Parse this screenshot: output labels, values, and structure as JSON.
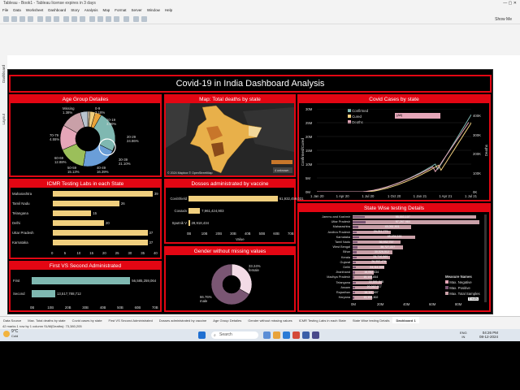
{
  "window": {
    "title": "Tableau - Book1 - Tableau license expires in 3 days"
  },
  "menu": [
    "File",
    "Data",
    "Worksheet",
    "Dashboard",
    "Story",
    "Analysis",
    "Map",
    "Format",
    "Server",
    "Window",
    "Help"
  ],
  "toolbar": {
    "show_me": "Show Me"
  },
  "side": {
    "dashboard": "Dashboard",
    "layout": "Layout"
  },
  "dashboard": {
    "title": "Covid-19 in India Dashboard Analysis",
    "age": {
      "title": "Age Group Detailes",
      "labels": [
        {
          "name": "Missing",
          "pct": "1.38%"
        },
        {
          "name": "0-9",
          "pct": "3.18%"
        },
        {
          "name": "10-19",
          "pct": "3.90%"
        },
        {
          "name": "20-29",
          "pct": "24.86%"
        },
        {
          "name": "30-39",
          "pct": "21.10%"
        },
        {
          "name": "40-49",
          "pct": "16.39%"
        },
        {
          "name": "50-59",
          "pct": "15.13%"
        },
        {
          "name": "60-69",
          "pct": "12.88%"
        },
        {
          "name": "70-79",
          "pct": "4.55%"
        }
      ]
    },
    "map": {
      "title": "Map: Total deaths by state",
      "credit": "© 2024 Mapbox © OpenStreetMap",
      "unknown": "4 unknown"
    },
    "cases": {
      "title": "Covid Cases by state",
      "legend": [
        "Confirmed",
        "Cured",
        "Deaths"
      ],
      "filter": "(All)",
      "ylabel_left": "Confirmed/Cured",
      "ylabel_right": "Deaths",
      "y_left_ticks": [
        "30M",
        "25M",
        "20M",
        "15M",
        "10M",
        "5M",
        "0M"
      ],
      "y_right_ticks": [
        "400K",
        "300K",
        "200K",
        "100K",
        "0K"
      ],
      "x_ticks": [
        "1 Jan 20",
        "1 Apr 20",
        "1 Jul 20",
        "1 Oct 20",
        "1 Jan 21",
        "1 Apr 21",
        "1 Jul 21"
      ]
    },
    "icmr": {
      "title": "ICMR Testing Labs in each State",
      "rows": [
        {
          "state": "Maharashtra",
          "value": "39"
        },
        {
          "state": "Tamil Nadu",
          "value": "26"
        },
        {
          "state": "Telangana",
          "value": "15"
        },
        {
          "state": "Delhi",
          "value": "20"
        },
        {
          "state": "Uttar Pradesh",
          "value": "37"
        },
        {
          "state": "Karnataka",
          "value": "37"
        }
      ],
      "axis": [
        "0",
        "5",
        "10",
        "15",
        "20",
        "25",
        "30",
        "35",
        "40"
      ]
    },
    "vaccine": {
      "title": "Dosses administrated by vaccine",
      "rows": [
        {
          "name": "CoviShield",
          "value": "61,932,459,031"
        },
        {
          "name": "Covaxin",
          "value": "7,961,424,903"
        },
        {
          "name": "Sputnik V",
          "value": "28,918,434"
        }
      ],
      "axis": [
        "0B",
        "10B",
        "20B",
        "30B",
        "40B",
        "50B",
        "60B",
        "70B"
      ],
      "xlabel": "Value"
    },
    "state_test": {
      "title": "State Wise testing Details",
      "rows": [
        {
          "state": "Jammu and Kashmir",
          "value": "95,003,107"
        },
        {
          "state": "Uttar Pradesh",
          "value": "97,267,984"
        },
        {
          "state": "Maharashtra",
          "value": "45,051,901"
        },
        {
          "state": "Andhra Pradesh",
          "value": "29,311,779"
        },
        {
          "state": "Karnataka",
          "value": "48,434,161"
        },
        {
          "state": "Tamil Nadu",
          "value": "36,932,757"
        },
        {
          "state": "West Bengal",
          "value": "38,727,227"
        },
        {
          "state": "Bihar",
          "value": "30,526,512"
        },
        {
          "state": "Kerala",
          "value": "28,710,569"
        },
        {
          "state": "Gujarat",
          "value": "26,352,476"
        },
        {
          "state": "Delhi",
          "value": "24,111,599"
        },
        {
          "state": "Jharkhand",
          "value": "16,052,034"
        },
        {
          "state": "Madhya Pradesh",
          "value": "15,144,844"
        },
        {
          "state": "Telangana",
          "value": "22,591,848"
        },
        {
          "state": "Assam",
          "value": "20,062,917"
        },
        {
          "state": "Rajasthan",
          "value": "16,111,497"
        },
        {
          "state": "Haryana",
          "value": "15,154,302"
        }
      ],
      "legend_title": "Measure Names",
      "legend": [
        "Max. Negative",
        "Max. Positive",
        "Max. Total Samples"
      ],
      "axis": [
        "0M",
        "20M",
        "40M",
        "60M",
        "80M"
      ],
      "more": "5 nulls"
    },
    "first_second": {
      "title": "First VS Second Administrated",
      "rows": [
        {
          "name": "First",
          "value": "56,585,259,064"
        },
        {
          "name": "Second",
          "value": "13,517,788,712"
        }
      ],
      "axis": [
        "0B",
        "10B",
        "20B",
        "30B",
        "40B",
        "50B",
        "60B",
        "70B"
      ]
    },
    "gender": {
      "title": "Gender without missing values",
      "female_pct": "33.24%",
      "female": "female",
      "male_pct": "66.76%",
      "male": "male"
    }
  },
  "tabs": [
    "Data Source",
    "Max. Total deaths by state",
    "Covid cases by state",
    "First VS Second Administrated",
    "Dosses administrated by vaccine",
    "Age Group Detailes",
    "Gender without missing values",
    "ICMR Testing Labs in each State",
    "State Wise testing Details",
    "Dashboard 1"
  ],
  "status": "42 marks  1 row by 1 column  SUM(Deaths): 73,380,205",
  "taskbar": {
    "weather_temp": "9°C",
    "weather_desc": "Cold",
    "search": "Search",
    "lang": "ENG\nIN",
    "time": "04:26 PM",
    "date": "08-12-2024"
  },
  "colors": {
    "accent": "#e30613",
    "bar": "#f0cf7e",
    "teal": "#7fb8b1",
    "mauve": "#7a5673",
    "pink": "#e5a6b8"
  }
}
